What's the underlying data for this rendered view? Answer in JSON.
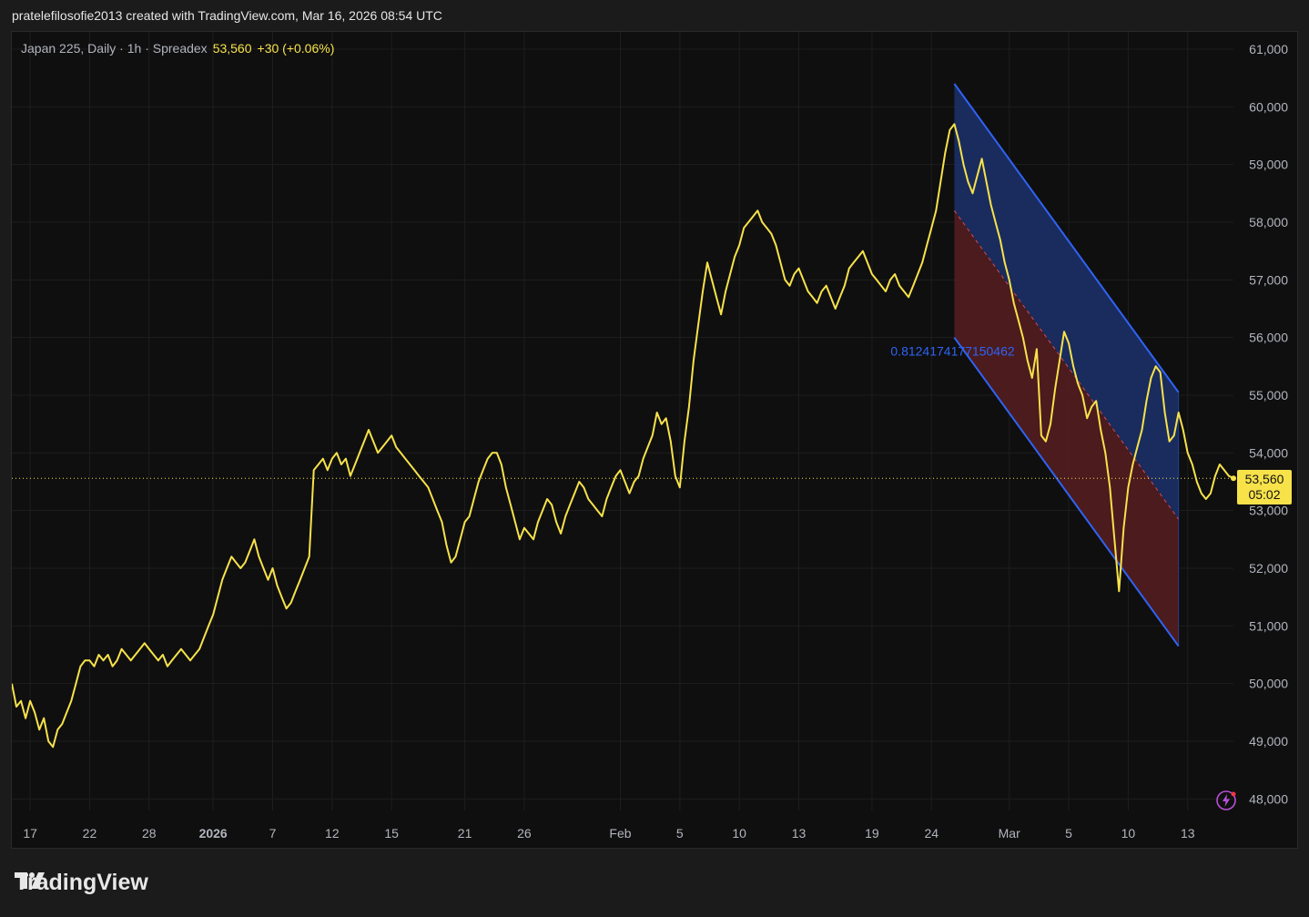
{
  "header": {
    "attribution": "pratelefilosofie2013 created with TradingView.com, Mar 16, 2026 08:54 UTC"
  },
  "legend": {
    "symbol": "Japan 225, Daily · 1h · Spreadex",
    "last": "53,560",
    "change": "+30 (+0.06%)"
  },
  "price_tag": {
    "price": "53,560",
    "countdown": "05:02"
  },
  "channel_label": "0.8124174177150462",
  "brand": {
    "name": "TradingView"
  },
  "colors": {
    "line": "#f7e24a",
    "channel_upper_fill": "#1b2e63",
    "channel_lower_fill": "#4f1c20",
    "channel_border": "#2f63f5",
    "background": "#0f0f0f"
  },
  "chart_data": {
    "type": "line",
    "title": "Japan 225, Daily · 1h · Spreadex",
    "xlabel": "",
    "ylabel": "",
    "ylim": [
      47800,
      61300
    ],
    "yticks": [
      "61,000",
      "60,000",
      "59,000",
      "58,000",
      "57,000",
      "56,000",
      "55,000",
      "54,000",
      "53,000",
      "52,000",
      "51,000",
      "50,000",
      "49,000",
      "48,000"
    ],
    "x_ticks": [
      {
        "label": "17",
        "i": 4
      },
      {
        "label": "22",
        "i": 17
      },
      {
        "label": "28",
        "i": 30
      },
      {
        "label": "2026",
        "i": 44,
        "bold": true
      },
      {
        "label": "7",
        "i": 57
      },
      {
        "label": "12",
        "i": 70
      },
      {
        "label": "15",
        "i": 83
      },
      {
        "label": "21",
        "i": 99
      },
      {
        "label": "26",
        "i": 112
      },
      {
        "label": "Feb",
        "i": 133
      },
      {
        "label": "5",
        "i": 146
      },
      {
        "label": "10",
        "i": 159
      },
      {
        "label": "13",
        "i": 172
      },
      {
        "label": "19",
        "i": 188
      },
      {
        "label": "24",
        "i": 201
      },
      {
        "label": "Mar",
        "i": 218
      },
      {
        "label": "5",
        "i": 231
      },
      {
        "label": "10",
        "i": 244
      },
      {
        "label": "13",
        "i": 257
      }
    ],
    "x_count": 268,
    "series": [
      {
        "values": [
          50000,
          49600,
          49700,
          49400,
          49700,
          49500,
          49200,
          49400,
          49000,
          48900,
          49200,
          49300,
          49500,
          49700,
          50000,
          50300,
          50400,
          50400,
          50300,
          50500,
          50400,
          50500,
          50300,
          50400,
          50600,
          50500,
          50400,
          50500,
          50600,
          50700,
          50600,
          50500,
          50400,
          50500,
          50300,
          50400,
          50500,
          50600,
          50500,
          50400,
          50500,
          50600,
          50800,
          51000,
          51200,
          51500,
          51800,
          52000,
          52200,
          52100,
          52000,
          52100,
          52300,
          52500,
          52200,
          52000,
          51800,
          52000,
          51700,
          51500,
          51300,
          51400,
          51600,
          51800,
          52000,
          52200,
          53700,
          53800,
          53900,
          53700,
          53900,
          54000,
          53800,
          53900,
          53600,
          53800,
          54000,
          54200,
          54400,
          54200,
          54000,
          54100,
          54200,
          54300,
          54100,
          54000,
          53900,
          53800,
          53700,
          53600,
          53500,
          53400,
          53200,
          53000,
          52800,
          52400,
          52100,
          52200,
          52500,
          52800,
          52900,
          53200,
          53500,
          53700,
          53900,
          54000,
          54000,
          53800,
          53400,
          53100,
          52800,
          52500,
          52700,
          52600,
          52500,
          52800,
          53000,
          53200,
          53100,
          52800,
          52600,
          52900,
          53100,
          53300,
          53500,
          53400,
          53200,
          53100,
          53000,
          52900,
          53200,
          53400,
          53600,
          53700,
          53500,
          53300,
          53500,
          53600,
          53900,
          54100,
          54300,
          54700,
          54500,
          54600,
          54200,
          53600,
          53400,
          54200,
          54800,
          55600,
          56200,
          56800,
          57300,
          57000,
          56700,
          56400,
          56800,
          57100,
          57400,
          57600,
          57900,
          58000,
          58100,
          58200,
          58000,
          57900,
          57800,
          57600,
          57300,
          57000,
          56900,
          57100,
          57200,
          57000,
          56800,
          56700,
          56600,
          56800,
          56900,
          56700,
          56500,
          56700,
          56900,
          57200,
          57300,
          57400,
          57500,
          57300,
          57100,
          57000,
          56900,
          56800,
          57000,
          57100,
          56900,
          56800,
          56700,
          56900,
          57100,
          57300,
          57600,
          57900,
          58200,
          58700,
          59200,
          59600,
          59700,
          59400,
          59000,
          58700,
          58500,
          58800,
          59100,
          58700,
          58300,
          58000,
          57700,
          57300,
          57000,
          56600,
          56300,
          56000,
          55600,
          55300,
          55800,
          54300,
          54200,
          54500,
          55100,
          55600,
          56100,
          55900,
          55500,
          55200,
          55000,
          54600,
          54800,
          54900,
          54400,
          54000,
          53400,
          52500,
          51600,
          52700,
          53400,
          53800,
          54100,
          54400,
          54900,
          55300,
          55500,
          55400,
          54700,
          54200,
          54300,
          54700,
          54400,
          54000,
          53800,
          53500,
          53300,
          53200,
          53300,
          53600,
          53800,
          53700,
          53600,
          53560
        ]
      }
    ],
    "channel": {
      "upper_start": [
        206,
        60400
      ],
      "upper_end": [
        255,
        55050
      ],
      "mid_start": [
        206,
        58200
      ],
      "mid_end": [
        255,
        52850
      ],
      "lower_start": [
        206,
        56000
      ],
      "lower_end": [
        255,
        50650
      ]
    },
    "last_price": 53560,
    "grid": true
  }
}
